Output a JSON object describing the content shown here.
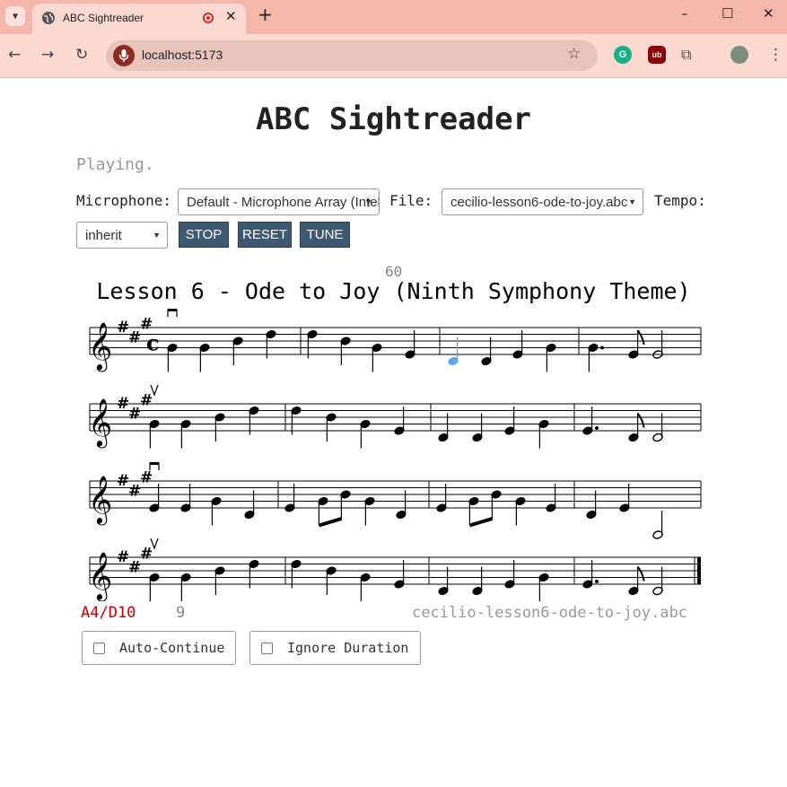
{
  "browser": {
    "tab_title": "ABC Sightreader",
    "new_tab": "+",
    "url": "localhost:5173",
    "minimize": "–",
    "maximize": "☐",
    "close": "✕",
    "ext_grammarly": "G",
    "ext_ublock": "ub"
  },
  "page": {
    "title": "ABC Sightreader",
    "status": "Playing."
  },
  "controls": {
    "microphone_label": "Microphone:",
    "microphone_value": "Default - Microphone Array (Intel®",
    "file_label": "File:",
    "file_value": "cecilio-lesson6-ode-to-joy.abc",
    "tempo_label": "Tempo:",
    "tempo_value": "inherit",
    "stop": "STOP",
    "reset": "RESET",
    "tune": "TUNE"
  },
  "score": {
    "tempo": "60",
    "title": "Lesson 6 - Ode to Joy (Ninth Symphony Theme)",
    "current_note": "A4/D10",
    "count": "9",
    "filename": "cecilio-lesson6-ode-to-joy.abc",
    "active_color": "#5aa6e8",
    "note_color": "#000000"
  },
  "options": {
    "auto_continue": "Auto-Continue",
    "ignore_duration": "Ignore Duration"
  }
}
